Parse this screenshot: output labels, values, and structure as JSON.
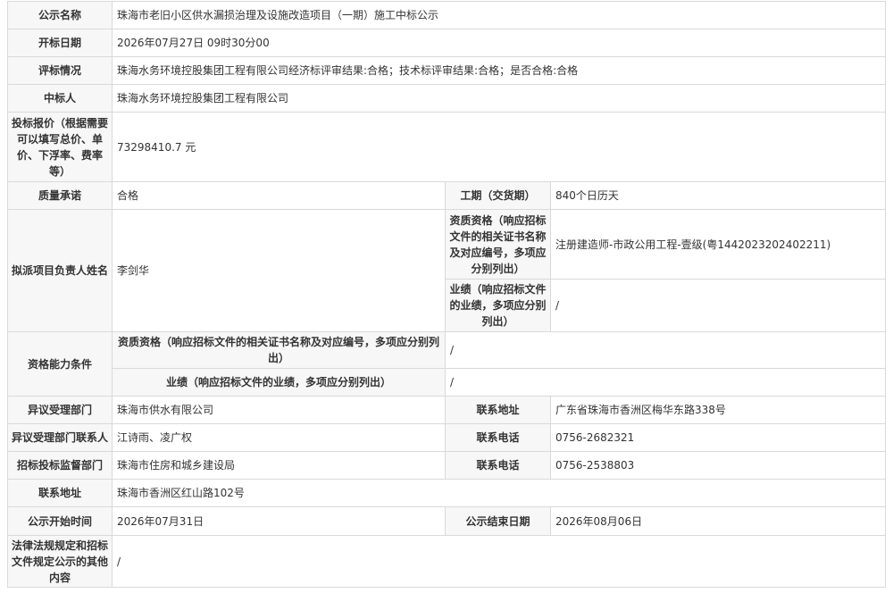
{
  "rows": {
    "name": {
      "label": "公示名称",
      "value": "珠海市老旧小区供水漏损治理及设施改造项目（一期）施工中标公示"
    },
    "open_date": {
      "label": "开标日期",
      "value": "2026年07月27日 09时30分00"
    },
    "evaluation": {
      "label": "评标情况",
      "value": "珠海水务环境控股集团工程有限公司经济标评审结果:合格；技术标评审结果:合格；是否合格:合格"
    },
    "winner": {
      "label": "中标人",
      "value": "珠海水务环境控股集团工程有限公司"
    },
    "bid_price": {
      "label": "投标报价（根据需要可以填写总价、单价、下浮率、费率等）",
      "value": "73298410.7 元"
    },
    "quality": {
      "label": "质量承诺",
      "value": "合格",
      "label2": "工期（交货期）",
      "value2": "840个日历天"
    },
    "manager": {
      "label": "拟派项目负责人姓名",
      "value": "李剑华",
      "qual_label": "资质资格（响应招标文件的相关证书名称及对应编号，多项应分别列出）",
      "qual_value": "注册建造师-市政公用工程-壹级(粤1442023202402211)",
      "perf_label": "业绩（响应招标文件的业绩，多项应分别列出）",
      "perf_value": "/"
    },
    "capability": {
      "label": "资格能力条件",
      "qual_label": "资质资格（响应招标文件的相关证书名称及对应编号，多项应分别列出）",
      "qual_value": "/",
      "perf_label": "业绩（响应招标文件的业绩，多项应分别列出）",
      "perf_value": "/"
    },
    "objection_dept": {
      "label": "异议受理部门",
      "value": "珠海市供水有限公司",
      "label2": "联系地址",
      "value2": "广东省珠海市香洲区梅华东路338号"
    },
    "objection_contact": {
      "label": "异议受理部门联系人",
      "value": "江诗雨、凌广权",
      "label2": "联系电话",
      "value2": "0756-2682321"
    },
    "supervisor": {
      "label": "招标投标监督部门",
      "value": "珠海市住房和城乡建设局",
      "label2": "联系电话",
      "value2": "0756-2538803"
    },
    "address": {
      "label": "联系地址",
      "value": "珠海市香洲区红山路102号"
    },
    "period": {
      "label": "公示开始时间",
      "value": "2026年07月31日",
      "label2": "公示结束日期",
      "value2": "2026年08月06日"
    },
    "other": {
      "label": "法律法规规定和招标文件规定公示的其他内容",
      "value": "/"
    }
  }
}
